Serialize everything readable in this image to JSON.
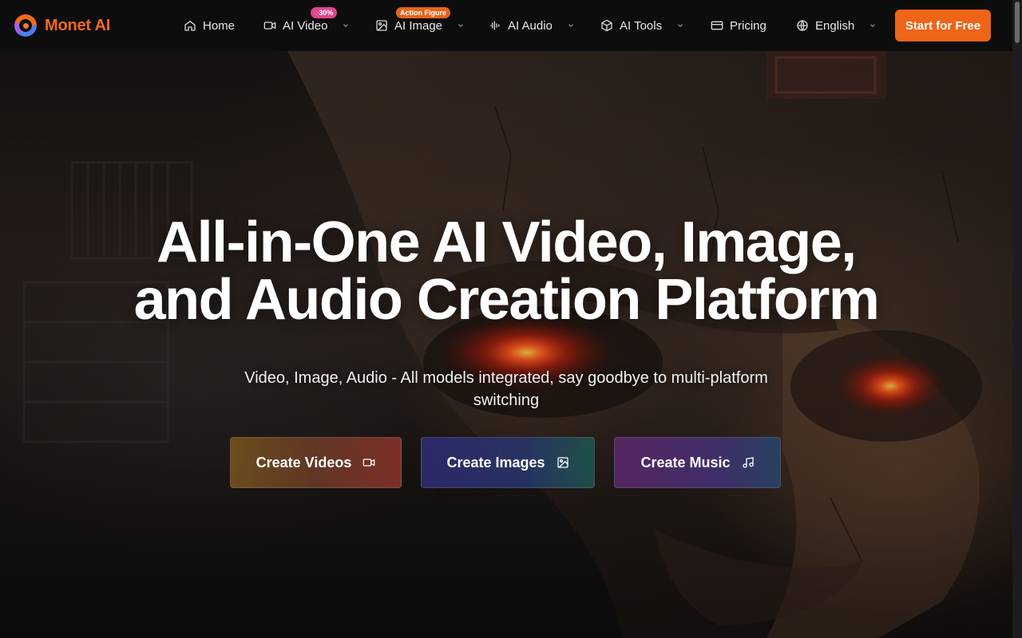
{
  "brand": {
    "name": "Monet AI",
    "color": "#f26a1b"
  },
  "nav": {
    "items": [
      {
        "label": "Home",
        "icon": "home-icon",
        "has_dropdown": false
      },
      {
        "label": "AI Video",
        "icon": "video-camera-icon",
        "has_dropdown": true,
        "badge": "30%",
        "badge_icon": "discount-tag-icon",
        "badge_color": "#e0448c"
      },
      {
        "label": "AI Image",
        "icon": "image-edit-icon",
        "has_dropdown": true,
        "badge": "Action Figure",
        "badge_color": "#e8631c"
      },
      {
        "label": "AI Audio",
        "icon": "audio-wave-icon",
        "has_dropdown": true
      },
      {
        "label": "AI Tools",
        "icon": "cube-icon",
        "has_dropdown": true
      },
      {
        "label": "Pricing",
        "icon": "card-icon",
        "has_dropdown": false
      },
      {
        "label": "English",
        "icon": "globe-icon",
        "has_dropdown": true
      }
    ],
    "cta_label": "Start for Free",
    "cta_color": "#ee6418"
  },
  "hero": {
    "title_line1": "All-in-One AI Video, Image,",
    "title_line2": "and Audio Creation Platform",
    "subtitle": "Video, Image, Audio - All models integrated, say goodbye to multi-platform switching",
    "buttons": [
      {
        "label": "Create Videos",
        "icon": "video-camera-icon"
      },
      {
        "label": "Create Images",
        "icon": "image-edit-icon"
      },
      {
        "label": "Create Music",
        "icon": "music-note-icon"
      }
    ]
  }
}
